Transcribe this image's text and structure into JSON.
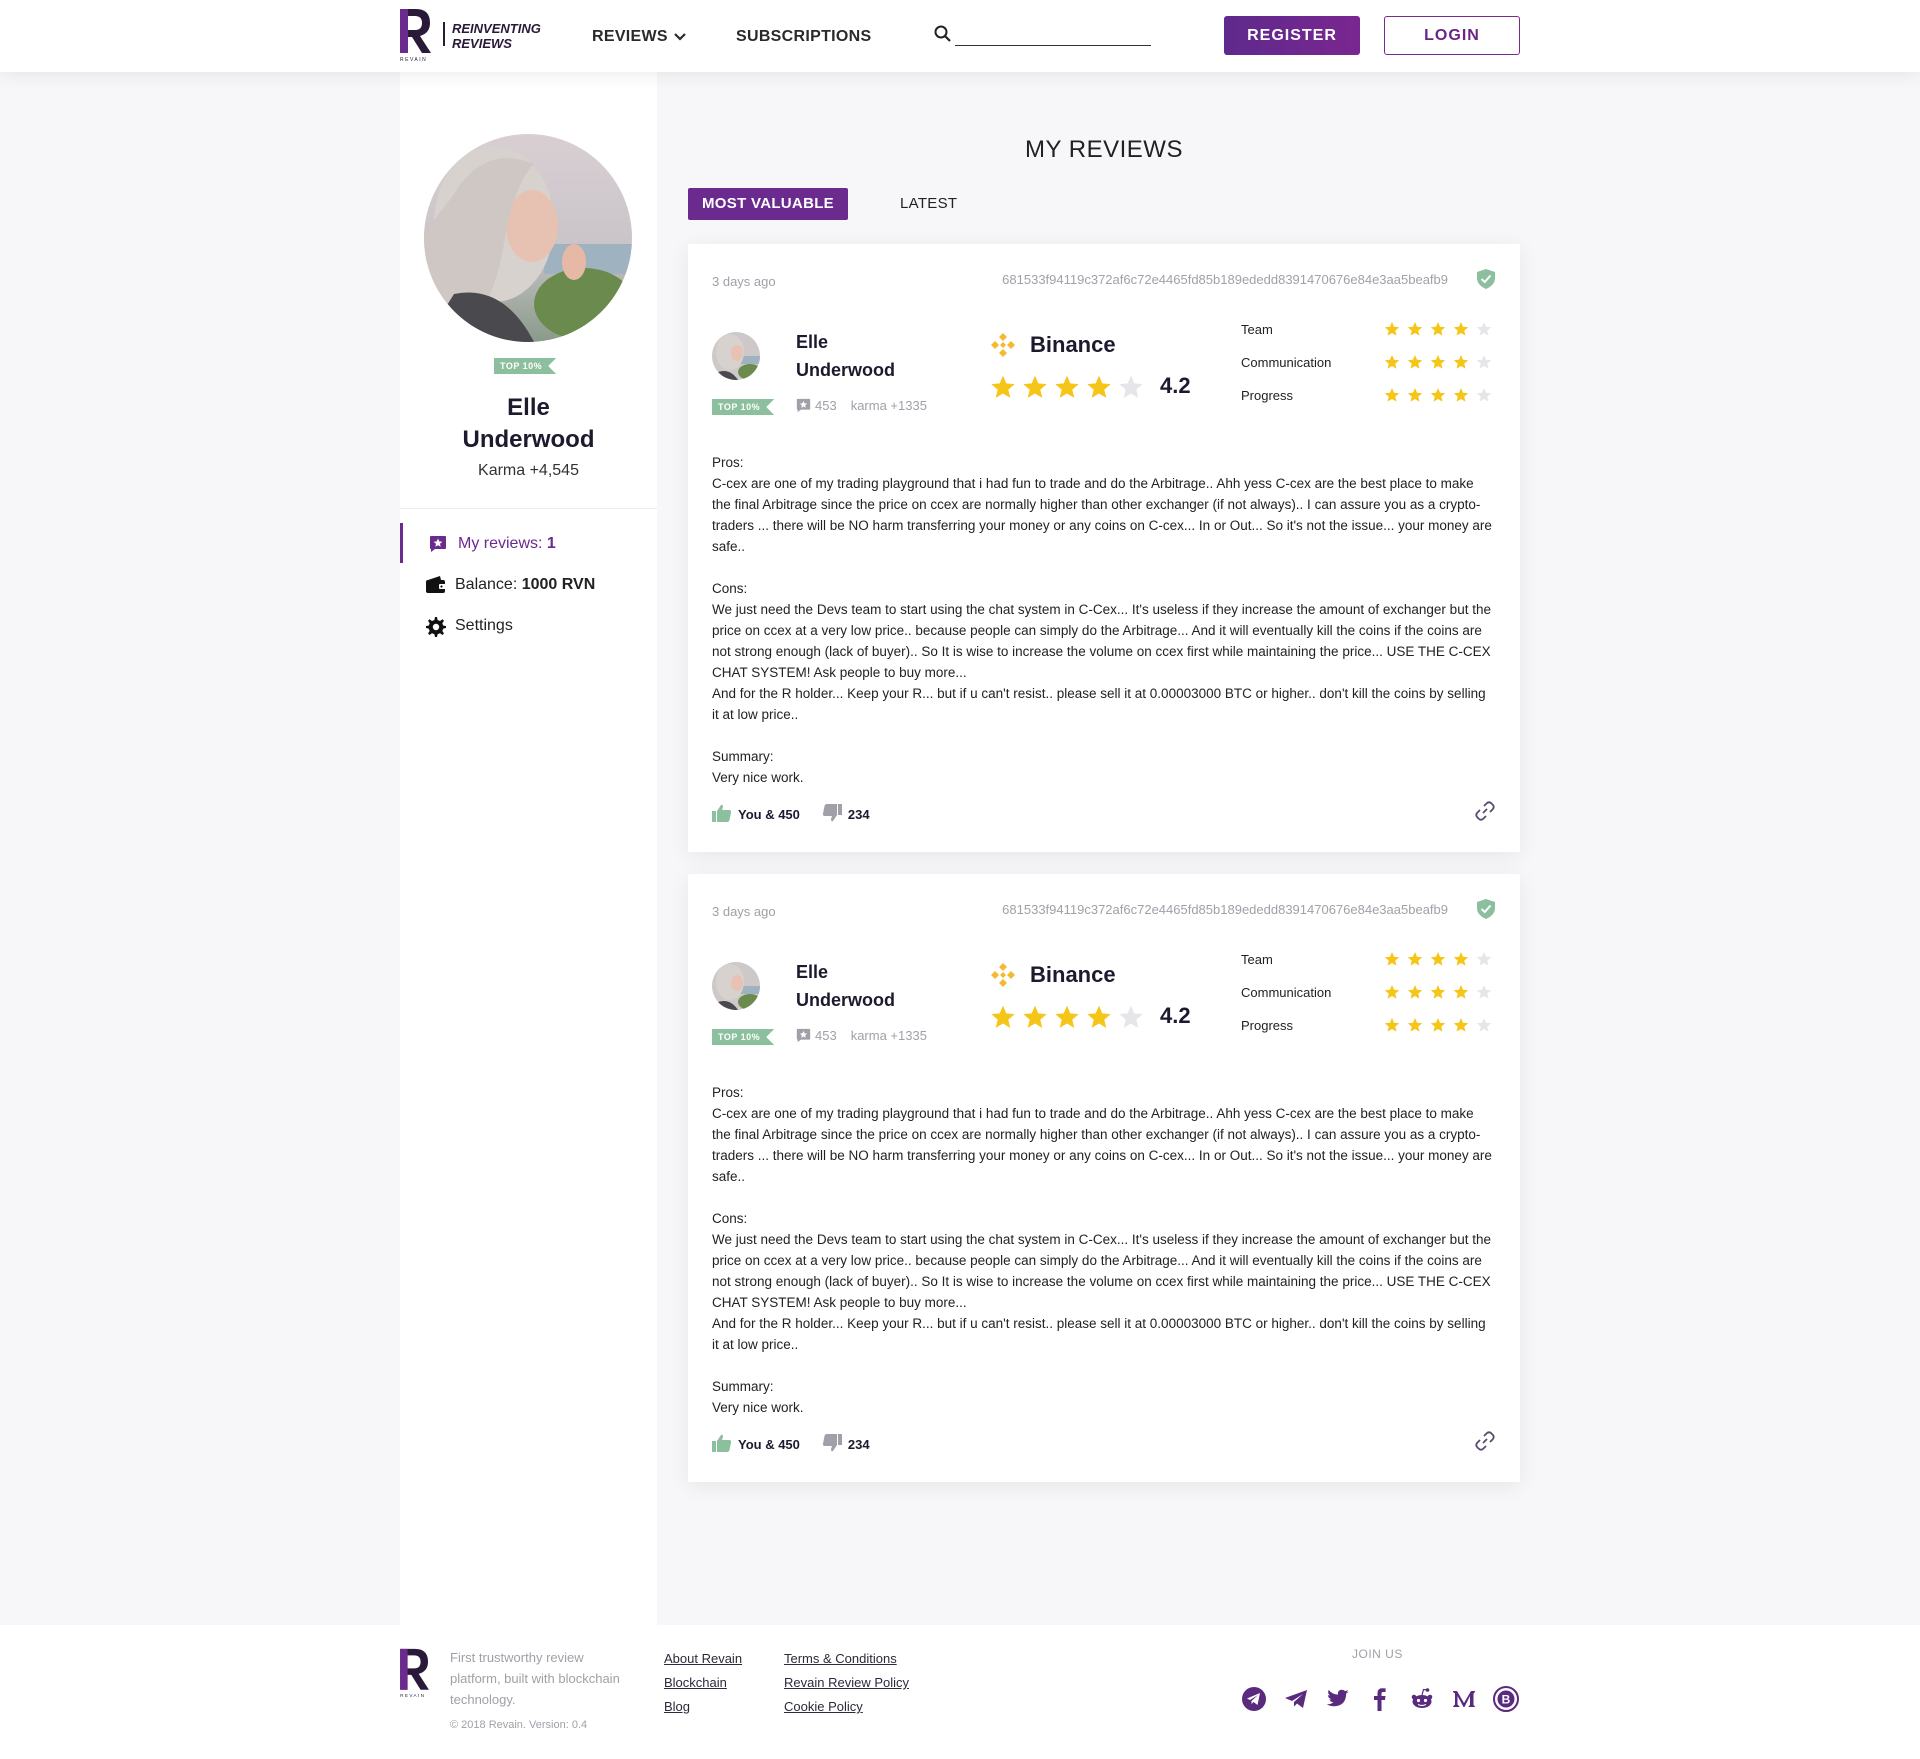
{
  "header": {
    "tagline_line1": "REINVENTING",
    "tagline_line2": "REVIEWS",
    "nav_reviews": "REVIEWS",
    "nav_subscriptions": "SUBSCRIPTIONS",
    "search_placeholder": "",
    "register": "REGISTER",
    "login": "LOGIN"
  },
  "sidebar": {
    "badge": "TOP 10%",
    "name_first": "Elle",
    "name_last": "Underwood",
    "karma": "Karma +4,545",
    "menu": [
      {
        "label": "My reviews: ",
        "value": "1",
        "icon": "star-chat-icon"
      },
      {
        "label": "Balance: ",
        "value": "1000 RVN",
        "icon": "wallet-icon"
      },
      {
        "label": "Settings",
        "value": "",
        "icon": "gear-icon"
      }
    ]
  },
  "main": {
    "title": "MY REVIEWS",
    "tab_valuable": "MOST VALUABLE",
    "tab_latest": "LATEST"
  },
  "reviews": [
    {
      "date": "3 days ago",
      "hash": "681533f94119c372af6c72e4465fd85b189ededd8391470676e84e3aa5beafb9",
      "author_first": "Elle",
      "author_last": "Underwood",
      "badge": "TOP 10%",
      "review_count": "453",
      "karma": "karma +1335",
      "company": "Binance",
      "rating": "4.2",
      "rating_stars": 4,
      "criteria": [
        {
          "name": "Team",
          "stars": 4
        },
        {
          "name": "Communication",
          "stars": 4
        },
        {
          "name": "Progress",
          "stars": 4
        }
      ],
      "body": "Pros:\nC-cex are one of my trading playground that i had fun to trade and do the Arbitrage.. Ahh yess C-cex are the best place to make the final Arbitrage since the price on ccex are normally higher than other exchanger (if not always)..  I can assure you as a crypto-traders ... there will be NO harm transferring your money or any coins on C-cex... In or Out... So it's not the issue... your money are safe..\n\nCons:\nWe just need the Devs team to start using the chat system in C-Cex... It's useless if they increase the amount of exchanger but the price on ccex at a very low price.. because people can simply do the Arbitrage... And it will eventually kill the coins if the coins are not strong enough (lack of buyer)..  So It is wise to increase the volume on ccex first while maintaining the price... USE THE C-CEX CHAT SYSTEM! Ask people to buy more...\nAnd for the R holder... Keep your R... but if u can't resist.. please sell it at 0.00003000 BTC or higher.. don't kill the coins by selling it at low price..\n\nSummary:\nVery nice work.",
      "likes": "You & 450",
      "dislikes": "234"
    },
    {
      "date": "3 days ago",
      "hash": "681533f94119c372af6c72e4465fd85b189ededd8391470676e84e3aa5beafb9",
      "author_first": "Elle",
      "author_last": "Underwood",
      "badge": "TOP 10%",
      "review_count": "453",
      "karma": "karma +1335",
      "company": "Binance",
      "rating": "4.2",
      "rating_stars": 4,
      "criteria": [
        {
          "name": "Team",
          "stars": 4
        },
        {
          "name": "Communication",
          "stars": 4
        },
        {
          "name": "Progress",
          "stars": 4
        }
      ],
      "body": "Pros:\nC-cex are one of my trading playground that i had fun to trade and do the Arbitrage.. Ahh yess C-cex are the best place to make the final Arbitrage since the price on ccex are normally higher than other exchanger (if not always)..  I can assure you as a crypto-traders ... there will be NO harm transferring your money or any coins on C-cex... In or Out... So it's not the issue... your money are safe..\n\nCons:\nWe just need the Devs team to start using the chat system in C-Cex... It's useless if they increase the amount of exchanger but the price on ccex at a very low price.. because people can simply do the Arbitrage... And it will eventually kill the coins if the coins are not strong enough (lack of buyer)..  So It is wise to increase the volume on ccex first while maintaining the price... USE THE C-CEX CHAT SYSTEM! Ask people to buy more...\nAnd for the R holder... Keep your R... but if u can't resist.. please sell it at 0.00003000 BTC or higher.. don't kill the coins by selling it at low price..\n\nSummary:\nVery nice work.",
      "likes": "You & 450",
      "dislikes": "234"
    }
  ],
  "footer": {
    "description": "First trustworthy review platform, built with blockchain technology.",
    "copyright": "© 2018 Revain. Version: 0.4",
    "links_col1": [
      "About Revain",
      "Blockchain",
      "Blog"
    ],
    "links_col2": [
      "Terms & Conditions",
      "Revain Review Policy",
      "Cookie Policy"
    ],
    "join_us": "JOIN US",
    "socials": [
      "telegram-channel-icon",
      "telegram-icon",
      "twitter-icon",
      "facebook-icon",
      "reddit-icon",
      "medium-icon",
      "bitcointalk-icon"
    ]
  },
  "colors": {
    "brand": "#6a2a8e",
    "star": "#f5c518",
    "star_empty": "#e6e6ea",
    "badge": "#8cbf9d",
    "binance": "#f3ba2f"
  }
}
